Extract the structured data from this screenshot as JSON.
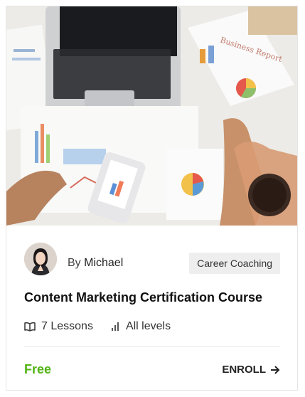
{
  "course": {
    "author_prefix": "By",
    "author_name": "Michael",
    "category": "Career Coaching",
    "title": "Content Marketing Certification Course",
    "lessons": "7 Lessons",
    "level": "All levels",
    "price": "Free",
    "enroll_label": "ENROLL"
  },
  "colors": {
    "price": "#52b415",
    "tag_bg": "#eeeeee"
  },
  "icons": {
    "lessons": "open-book-icon",
    "level": "bar-chart-icon",
    "enroll": "arrow-right-icon"
  }
}
